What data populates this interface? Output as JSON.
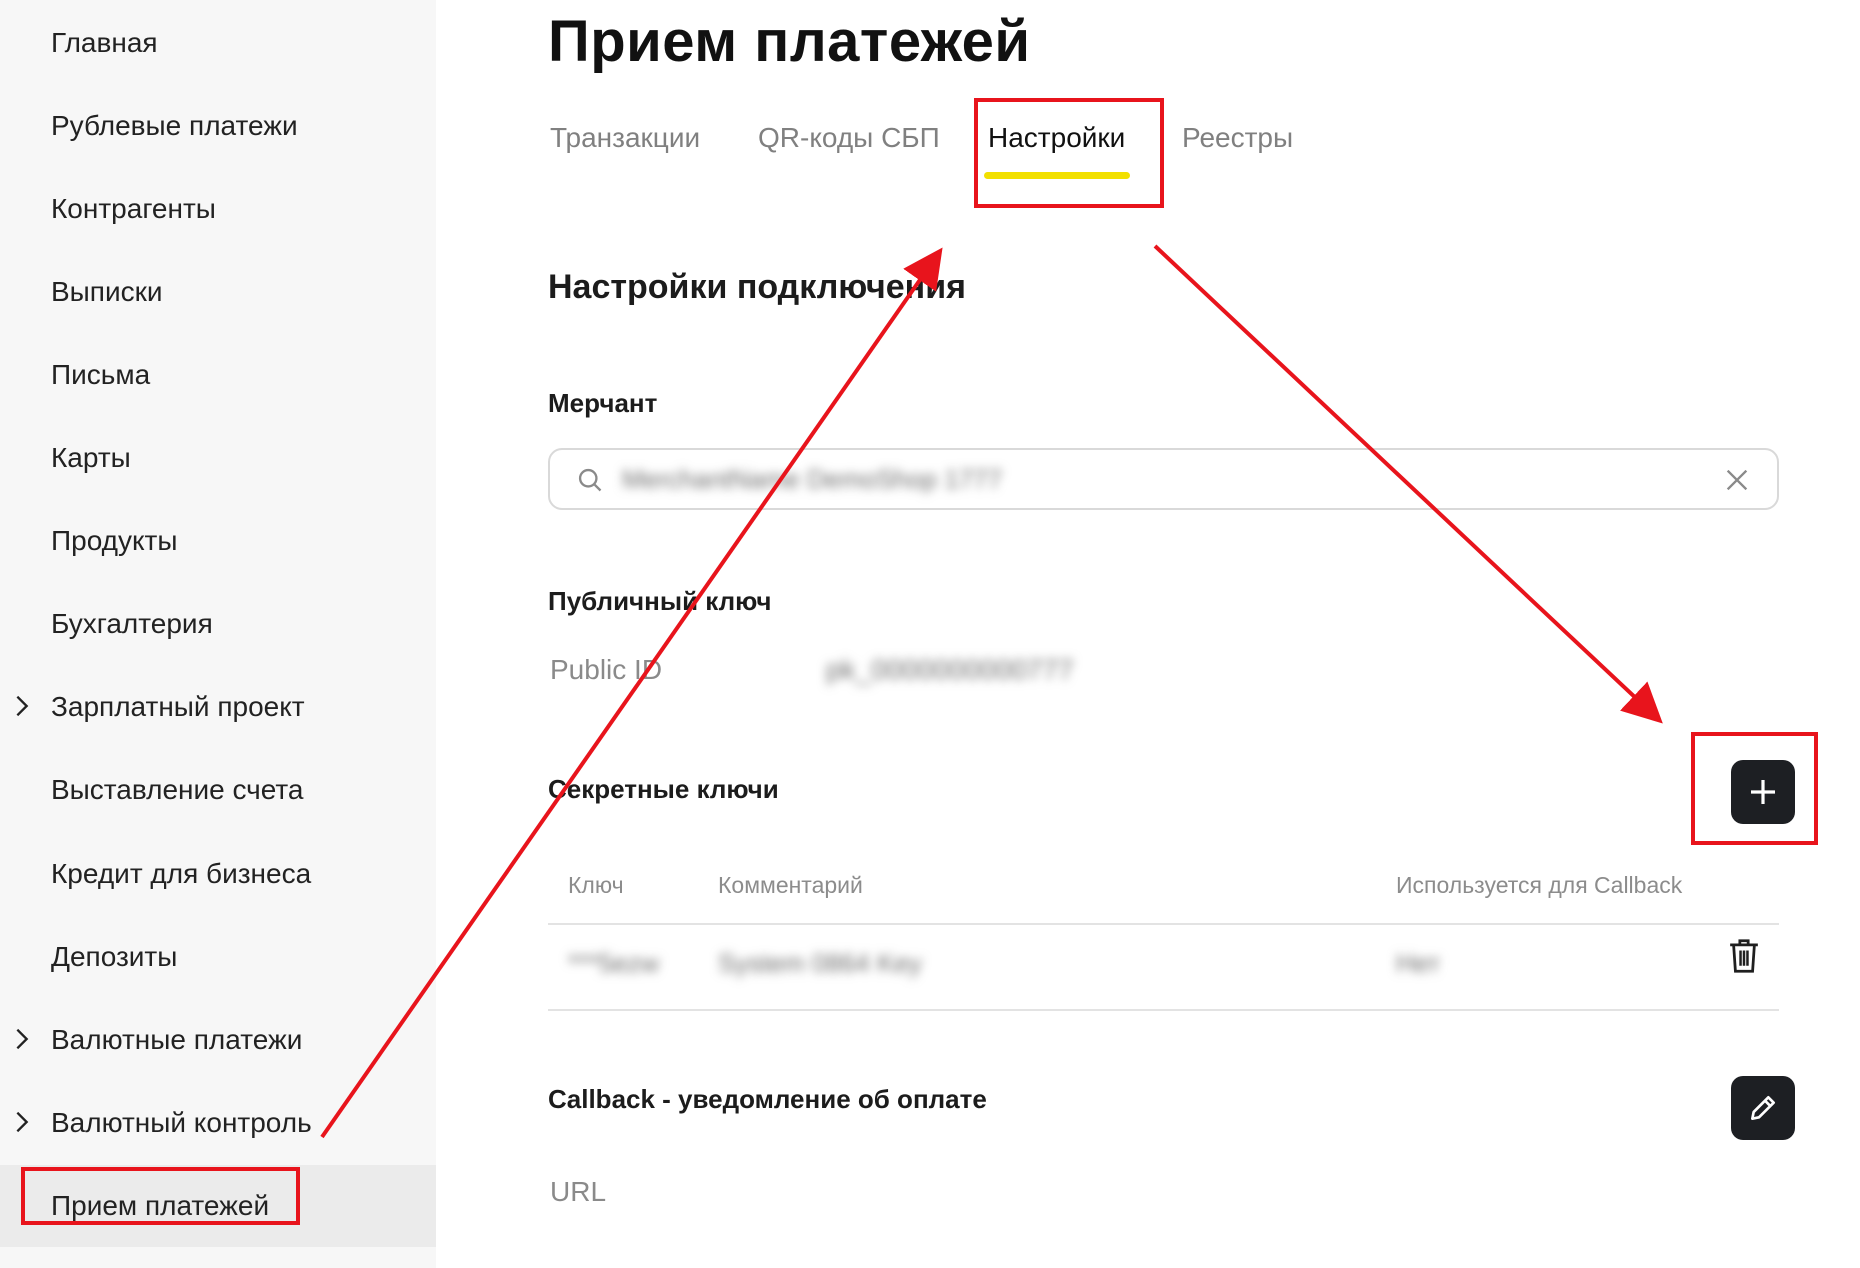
{
  "sidebar": {
    "items": [
      {
        "label": "Главная"
      },
      {
        "label": "Рублевые платежи"
      },
      {
        "label": "Контрагенты"
      },
      {
        "label": "Выписки"
      },
      {
        "label": "Письма"
      },
      {
        "label": "Карты"
      },
      {
        "label": "Продукты"
      },
      {
        "label": "Бухгалтерия"
      },
      {
        "label": "Зарплатный проект",
        "icon": "chevron-right-icon"
      },
      {
        "label": "Выставление счета"
      },
      {
        "label": "Кредит для бизнеса"
      },
      {
        "label": "Депозиты"
      },
      {
        "label": "Валютные платежи",
        "icon": "chevron-right-icon"
      },
      {
        "label": "Валютный контроль",
        "icon": "chevron-right-icon"
      },
      {
        "label": "Прием платежей",
        "active": true
      }
    ]
  },
  "header": {
    "title": "Прием платежей"
  },
  "tabs": [
    {
      "label": "Транзакции"
    },
    {
      "label": "QR-коды СБП"
    },
    {
      "label": "Настройки",
      "active": true
    },
    {
      "label": "Реестры"
    }
  ],
  "settings": {
    "section_title": "Настройки подключения",
    "merchant": {
      "label": "Мерчант",
      "value": "MerchantName DemoShop 1777",
      "icons": [
        "search-icon",
        "close-icon"
      ]
    },
    "public_key": {
      "label": "Публичный ключ",
      "field_label": "Public ID",
      "value": "pk_0000000000777"
    },
    "secret_keys": {
      "label": "Секретные ключи",
      "add_icon": "plus-icon",
      "columns": [
        "Ключ",
        "Комментарий",
        "Используется для Callback"
      ],
      "rows": [
        {
          "key": "***5ezw",
          "comment": "System 0864 Key",
          "callback": "Нет",
          "delete_icon": "trash-icon"
        }
      ]
    },
    "callback": {
      "label": "Callback - уведомление об оплате",
      "edit_icon": "pencil-icon",
      "url_label": "URL"
    }
  },
  "colors": {
    "accent_underline": "#f2e000",
    "annotation_red": "#e8141c",
    "button_dark": "#1d1f23"
  }
}
